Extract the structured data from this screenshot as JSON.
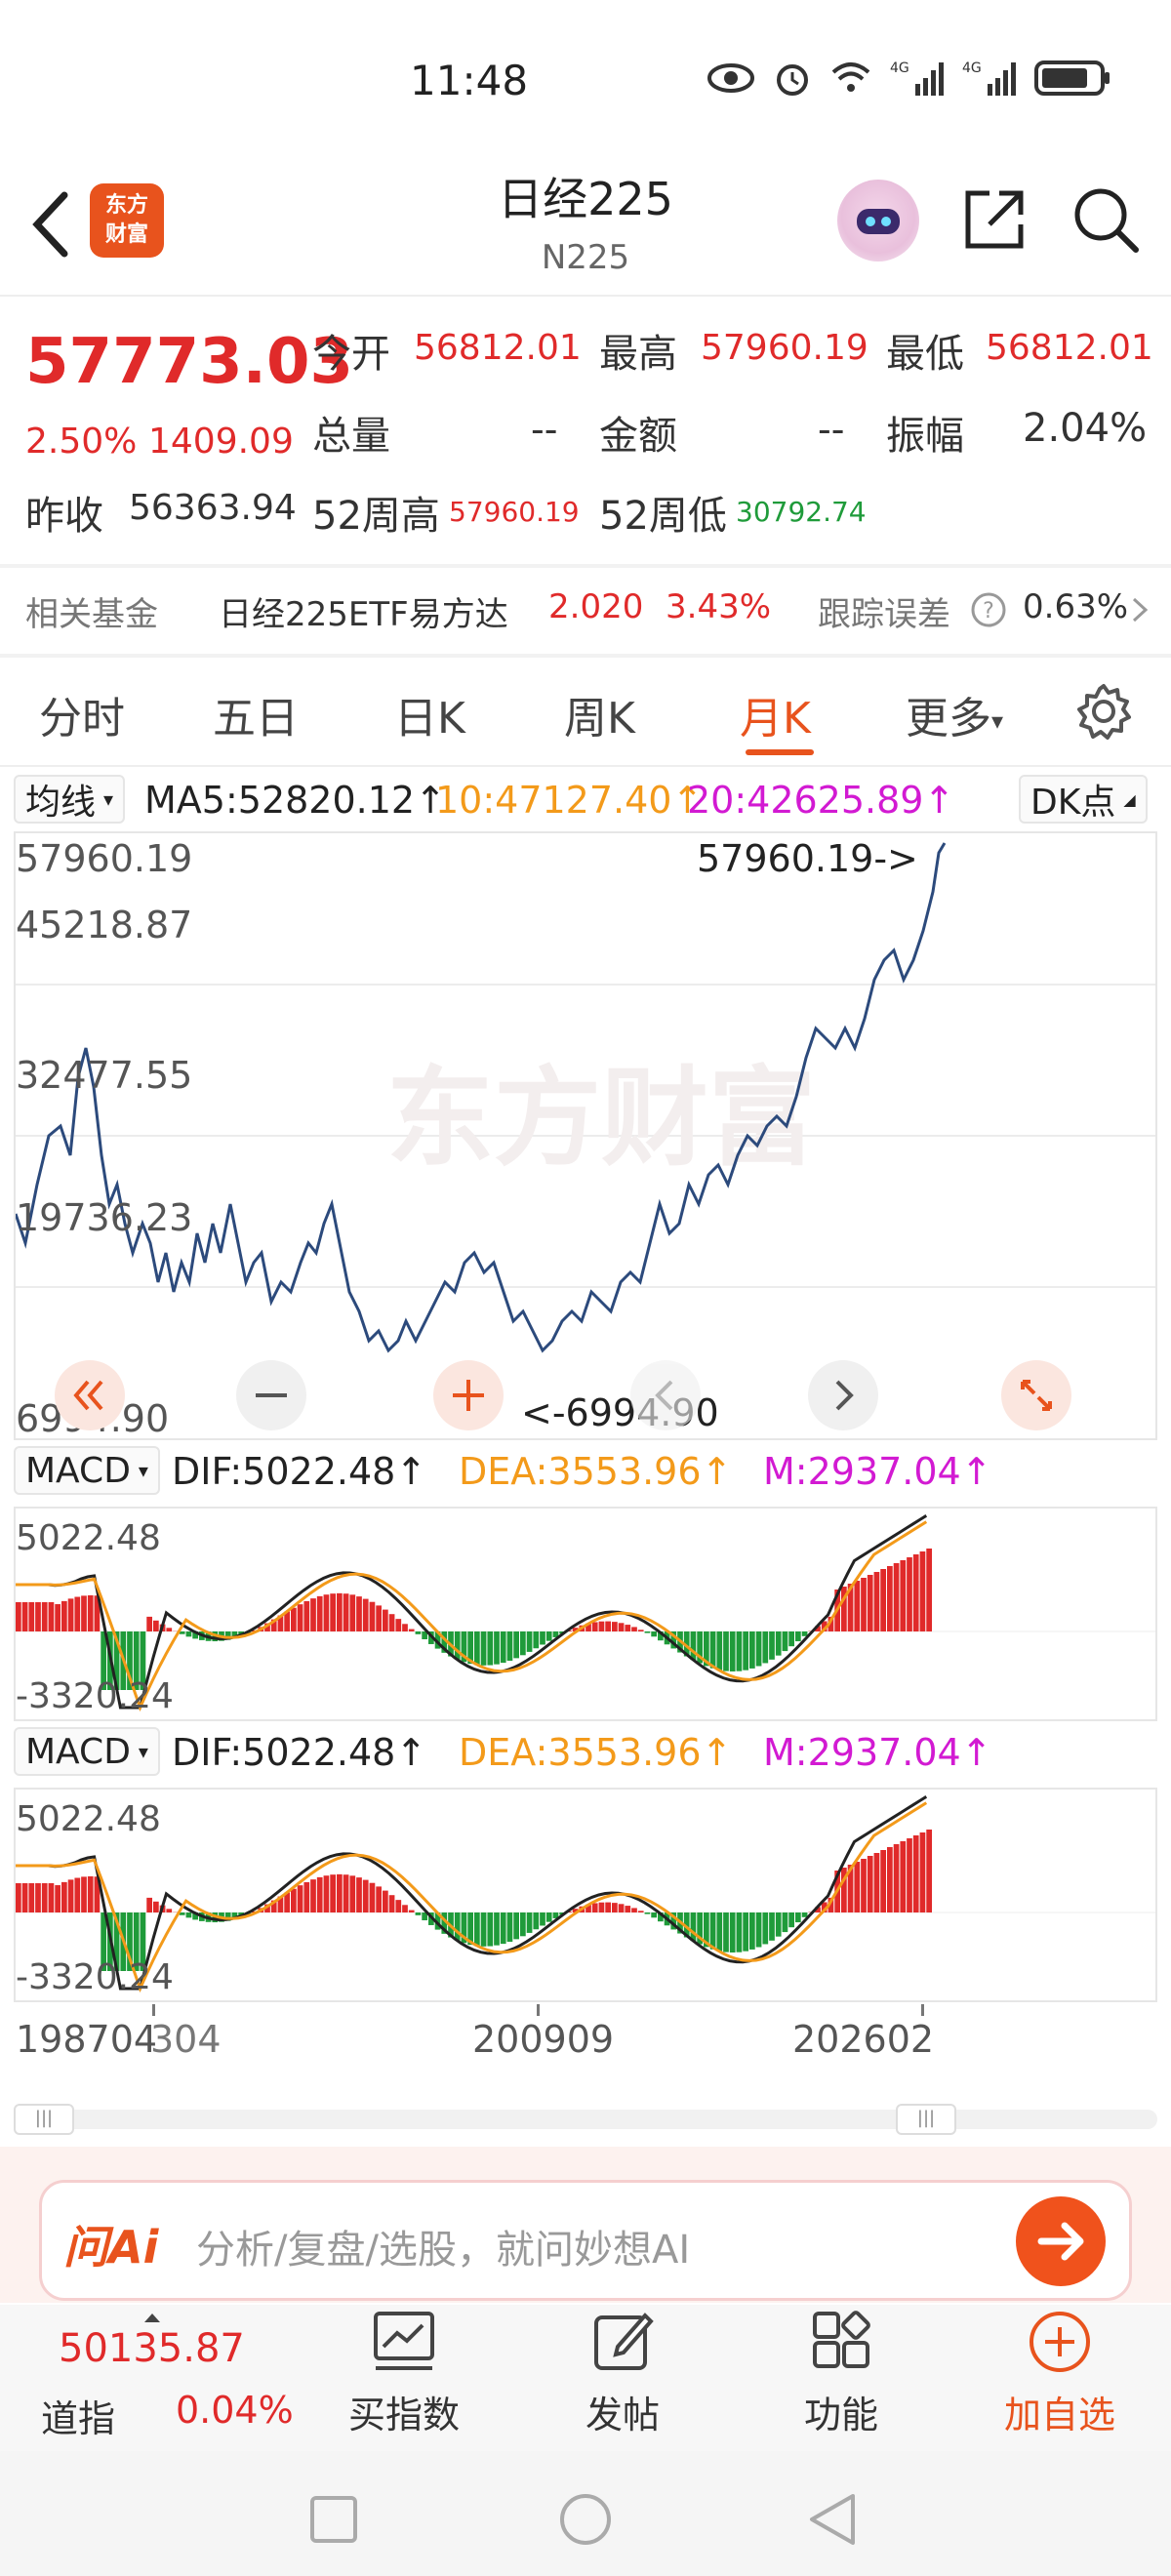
{
  "status": {
    "time": "11:48"
  },
  "header": {
    "title": "日经225",
    "subtitle": "N225",
    "logo_text_1": "东方",
    "logo_text_2": "财富"
  },
  "quote": {
    "price": "57773.03",
    "change_pct": "2.50%",
    "change": "1409.09",
    "open_label": "今开",
    "open": "56812.01",
    "high_label": "最高",
    "high": "57960.19",
    "low_label": "最低",
    "low": "56812.01",
    "volume_label": "总量",
    "volume": "--",
    "amount_label": "金额",
    "amount": "--",
    "amplitude_label": "振幅",
    "amplitude": "2.04%",
    "prev_close_label": "昨收",
    "prev_close": "56363.94",
    "wk52_high_label": "52周高",
    "wk52_high": "57960.19",
    "wk52_low_label": "52周低",
    "wk52_low": "30792.74"
  },
  "fund": {
    "label": "相关基金",
    "name": "日经225ETF易方达",
    "price": "2.020",
    "pct": "3.43%",
    "track_label": "跟踪误差",
    "track_value": "0.63%"
  },
  "tabs": [
    "分时",
    "五日",
    "日K",
    "周K",
    "月K",
    "更多"
  ],
  "ma": {
    "selector": "均线",
    "ma5": "MA5:52820.12↑",
    "ma10": "10:47127.40↑",
    "ma20": "20:42625.89↑",
    "dk": "DK点"
  },
  "price_axis": [
    "57960.19",
    "45218.87",
    "32477.55",
    "19736.23",
    "6994.90"
  ],
  "max_marker": "57960.19->",
  "min_marker": "<-6994.90",
  "watermark": "东方财富",
  "macd": {
    "selector": "MACD",
    "dif": "DIF:5022.48↑",
    "dea": "DEA:3553.96↑",
    "m": "M:2937.04↑",
    "axis_top": "5022.48",
    "axis_bottom": "-3320.24"
  },
  "date_axis": [
    "198704",
    "304",
    "200909",
    "202602"
  ],
  "ai": {
    "brand": "问Ai",
    "placeholder": "分析/复盘/选股，就问妙想AI"
  },
  "bottom_nav": {
    "index_value": "50135.87",
    "index_name": "道指",
    "index_pct": "0.04%",
    "buy_index": "买指数",
    "post": "发帖",
    "features": "功能",
    "add_watch": "加自选"
  },
  "colors": {
    "up": "#e02a2a",
    "down": "#1f9b3a",
    "accent": "#e8531d",
    "line": "#2c4a7c",
    "dea": "#f39a1a",
    "m": "#d21ad2"
  }
}
